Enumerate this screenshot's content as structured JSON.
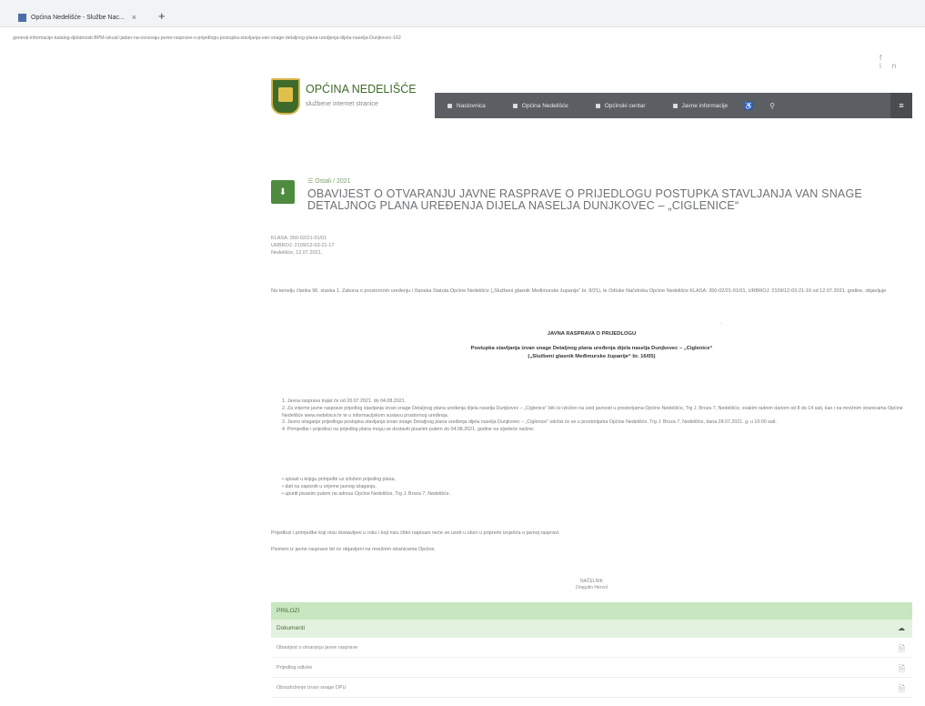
{
  "browser": {
    "tab_title": "Općina Nedelišće - Službe Nac...",
    "tab_close": "×",
    "new_tab": "+",
    "address": "general-informacije-katalog-djelatnosti-BPM-iskusi/-jadan-na-osnovaju-javne-rasprave-o-prijedlogu-postupka-stavljanja-van-snage-detaljnog-plana-uredjenja-dijela-naselja-Dunjkovec-162"
  },
  "top_icons": "f in",
  "site": {
    "name": "OPĆINA NEDELIŠĆE",
    "tagline": "službene internet stranice"
  },
  "nav": {
    "items": [
      "Naslovnica",
      "Općina Nedelišće",
      "Općinski centar",
      "Javne informacije"
    ],
    "icon_a": "♿",
    "icon_search": "⚲",
    "menu": "≡"
  },
  "article": {
    "download_icon": "⬇",
    "category": "☰ Ostali / 2021",
    "title": "OBAVIJEST O OTVARANJU JAVNE RASPRAVE O PRIJEDLOGU POSTUPKA STAVLJANJA VAN SNAGE DETALJNOG PLANA UREĐENJA DIJELA NASELJA DUNJKOVEC – „CIGLENICE“",
    "meta": [
      "KLASA: 350-02/21-01/01",
      "URBROJ: 2109/12-03-21-17",
      "Nedelišće, 12.07.2021."
    ],
    "intro": "Na temelju članka 96. stavka 1. Zakona o prostornom uređenju i članaka Statuta Općine Nedelišće („Službeni glasnik Međimurske županije“ br. 8/21), te Odluke Načelnika Općine Nedelišće KLASA: 350-02/21-01/01, URBROJ: 2109/12-03-21-16 od 12.07.2021. godine, objavljuje",
    "heading1": "JAVNA RASPRAVA O PRIJEDLOGU",
    "heading2": "Postupka stavljanja izvan snage Detaljnog plana uređenja dijela naselja Dunjkovec – „Ciglenice“",
    "heading3": "(„Službeni glasnik Međimurske županije“ br. 16/05)",
    "tick": "-",
    "list": [
      "1. Javna rasprava trajat će od 20.07.2021. do 04.08.2021.",
      "2. Za vrijeme javne rasprave prijedlog stavljanja izvan snage Detaljnog plana uređenja dijela naselja Dunjkovec – „Ciglenice“ biti će izložen na uvid javnosti u prostorijama Općine Nedelišće, Trg J. Broza 7, Nedelišće, svakim radnim danom od 8 do 14 sati, kao i na mrežnim stranicama Općine Nedelišće www.nedelisce.hr te u informacijskom sustavu prostornog uređenja.",
      "3. Javno izlaganje prijedloga postupka stavljanja izvan snage Detaljnog plana uređenja dijela naselja Dunjkovec – „Ciglenice“ održat će se u prostorijama Općine Nedelišće, Trg J. Broza 7, Nedelišće, dana 28.07.2021. g. u 10:00 sati.",
      "4. Primjedbe i prijedlozi na prijedlog plana mogu se dostaviti pisanim putem do 04.08.2021. godine na sljedeće načine:"
    ],
    "bullets": [
      "• upisati u knjigu primjedbi uz izloženi prijedlog plana,",
      "• dati na zapisnik u vrijeme javnog izlaganja,",
      "• uputiti pisanim putem na adresu Općine Nedelišće, Trg J. Broza 7, Nedelišće."
    ],
    "note1": "Prijedlozi i primjedbe koji nisu dostavljeni u roku i koji nisu čitko napisani neće se uzeti u obzir u pripremi izvješća o javnoj raspravi.",
    "note2": "Pismeni iz javne rasprave bit će objavljeni na mrežnim stranicama Općine.",
    "sign1": "NAČELNIK",
    "sign2": "Dragutin Hervol"
  },
  "attachments": {
    "header": "PRILOZI",
    "group": "Dokumenti",
    "group_icon": "☁",
    "rows": [
      "Obavijest o otvaranju javne rasprave",
      "Prijedlog odluke",
      "Obrazloženje izvan snage DPU"
    ],
    "row_icon": "🗎"
  }
}
